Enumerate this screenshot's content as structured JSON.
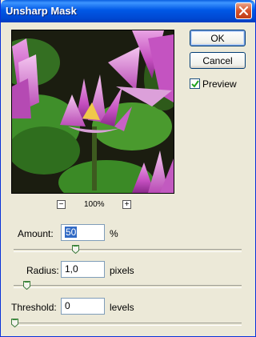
{
  "window": {
    "title": "Unsharp Mask"
  },
  "buttons": {
    "ok": "OK",
    "cancel": "Cancel"
  },
  "preview": {
    "checkbox_label": "Preview",
    "checked": true,
    "zoom_level": "100%",
    "zoom_out": "−",
    "zoom_in": "+"
  },
  "params": {
    "amount": {
      "label": "Amount:",
      "value": "50",
      "unit": "%",
      "slider_fraction": 0.27
    },
    "radius": {
      "label": "Radius:",
      "value": "1,0",
      "unit": "pixels",
      "slider_fraction": 0.05
    },
    "threshold": {
      "label": "Threshold:",
      "value": "0",
      "unit": "levels",
      "slider_fraction": 0.0
    }
  },
  "colors": {
    "titlebar": "#0058e6",
    "dialog_bg": "#ece9d8",
    "selection": "#316ac5",
    "slider_thumb": "#3c9a3c"
  }
}
